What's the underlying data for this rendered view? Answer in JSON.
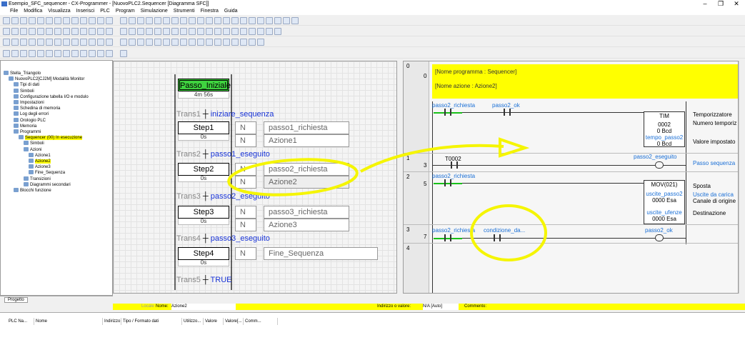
{
  "window": {
    "title": "Esempio_SFC_sequencer - CX-Programmer - [NuovoPLC2.Sequencer [Diagramma SFC]]",
    "min": "–",
    "max": "❐",
    "close": "✕"
  },
  "menu": [
    "File",
    "Modifica",
    "Visualizza",
    "Inserisci",
    "PLC",
    "Program",
    "Simulazione",
    "Strumenti",
    "Finestra",
    "Guida"
  ],
  "tree": {
    "items": [
      {
        "label": "Stella_Triangolo",
        "indent": 0
      },
      {
        "label": "NuovoPLC2[CJ2M] Modalità Monitor",
        "indent": 1
      },
      {
        "label": "Tipi di dati",
        "indent": 2
      },
      {
        "label": "Simboli",
        "indent": 2
      },
      {
        "label": "Configurazione tabella I/O e modulo",
        "indent": 2
      },
      {
        "label": "Impostazioni",
        "indent": 2
      },
      {
        "label": "Schedina di memoria",
        "indent": 2
      },
      {
        "label": "Log degli errori",
        "indent": 2
      },
      {
        "label": "Orologio PLC",
        "indent": 2
      },
      {
        "label": "Memoria",
        "indent": 2
      },
      {
        "label": "Programmi",
        "indent": 2
      },
      {
        "label": "Sequencer (00) In esecuzione",
        "indent": 3,
        "highlight": true
      },
      {
        "label": "Simboli",
        "indent": 4
      },
      {
        "label": "Azioni",
        "indent": 4
      },
      {
        "label": "Azione1",
        "indent": 5
      },
      {
        "label": "Azione2",
        "indent": 5,
        "highlight": true
      },
      {
        "label": "Azione3",
        "indent": 5
      },
      {
        "label": "Fine_Sequenza",
        "indent": 5
      },
      {
        "label": "Transizioni",
        "indent": 4
      },
      {
        "label": "Diagrammi secondari",
        "indent": 4
      },
      {
        "label": "Blocchi funzione",
        "indent": 2
      }
    ],
    "tab": "Progetto"
  },
  "sfc": {
    "initial": {
      "name": "Passo_Iniziale",
      "time": "4m 56s"
    },
    "steps": [
      {
        "name": "Step1",
        "time": "0s",
        "actions": [
          {
            "q": "N",
            "name": "passo1_richiesta"
          },
          {
            "q": "N",
            "name": "Azione1"
          }
        ]
      },
      {
        "name": "Step2",
        "time": "0s",
        "actions": [
          {
            "q": "N",
            "name": "passo2_richiesta"
          },
          {
            "q": "N",
            "name": "Azione2"
          }
        ]
      },
      {
        "name": "Step3",
        "time": "0s",
        "actions": [
          {
            "q": "N",
            "name": "passo3_richiesta"
          },
          {
            "q": "N",
            "name": "Azione3"
          }
        ]
      },
      {
        "name": "Step4",
        "time": "0s",
        "actions": [
          {
            "q": "N",
            "name": "Fine_Sequenza"
          }
        ]
      }
    ],
    "transitions": [
      {
        "label": "Trans1",
        "cond": "iniziare_sequenza"
      },
      {
        "label": "Trans2",
        "cond": "passo1_eseguito"
      },
      {
        "label": "Trans3",
        "cond": "passo2_eseguito"
      },
      {
        "label": "Trans4",
        "cond": "passo3_eseguito"
      },
      {
        "label": "Trans5",
        "cond": "TRUE"
      }
    ]
  },
  "ladder": {
    "header": {
      "row": "0",
      "step": "0",
      "prog": "[Nome programma : Sequencer]",
      "action": "[Nome azione : Azione2]"
    },
    "rung0": {
      "c1": "passo2_richiesta",
      "c2": "passo2_ok",
      "tim": "TIM",
      "tim_n": "0002",
      "tim_v": "0 Bcd",
      "tim_sp": "tempo_passo2",
      "tim_spv": "0 Bcd",
      "cm1": "Temporizzatore",
      "cm2": "Numero temporiz",
      "cm3": "Valore impostato"
    },
    "rung1": {
      "row": "1",
      "step": "3",
      "c1": "T0002",
      "out": "passo2_eseguito",
      "cm": "Passo sequenza"
    },
    "rung2": {
      "row": "2",
      "step": "5",
      "c1": "passo2_richiesta",
      "mov": "MOV(021)",
      "s": "uscite_passo2",
      "sv": "0000 Esa",
      "d": "uscite_ufenze",
      "dv": "0000 Esa",
      "cm1": "Sposta",
      "cm2": "Uscite da carica",
      "cm3": "Canale di origine",
      "cm4": "Destinazione"
    },
    "rung3": {
      "row": "3",
      "step": "7",
      "c1": "passo2_richiesta",
      "c2": "condizione_da...",
      "out": "passo2_ok"
    },
    "row4": "4"
  },
  "status": {
    "locale": "Locale",
    "name_label": "Nome:",
    "name": "Azione2",
    "addr_label": "Indirizzo o valore:",
    "addr": "N/A [Auto]",
    "comment_label": "Commento:"
  },
  "bottom": {
    "cols": [
      "PLC Na...",
      "Nome",
      "Indirizzo",
      "Tipo / Formato dati",
      "Utilizzo...",
      "Valore",
      "Valore[...",
      "Comm..."
    ]
  },
  "colors": {
    "highlight": "#ffff00",
    "active_step": "#3fd33f",
    "contact_on": "#18c018",
    "annotation": "#f5f500"
  }
}
